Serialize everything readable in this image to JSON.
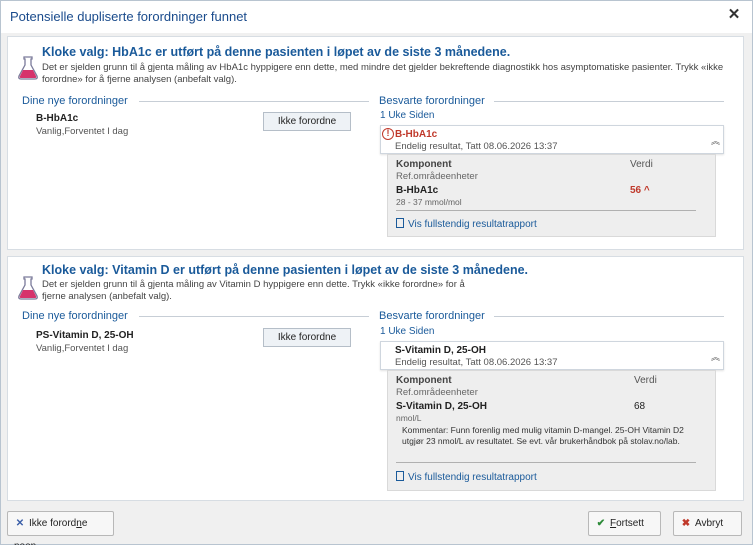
{
  "dialog": {
    "title": "Potensielle dupliserte forordninger funnet",
    "close_label": "✕"
  },
  "cards": [
    {
      "heading": "Kloke valg: HbA1c er utført på denne pasienten i løpet av de siste 3 månedene.",
      "description": "Det er sjelden grunn til å gjenta måling av HbA1c hyppigere enn dette, med mindre det gjelder bekreftende diagnostikk hos asymptomatiske pasienter. Trykk «ikke forordne» for å fjerne analysen (anbefalt valg).",
      "new_orders_label": "Dine nye forordninger",
      "order_name": "B-HbA1c",
      "order_sub": "Vanlig,Forventet I dag",
      "ikke_button": "Ikke forordne",
      "answered_label": "Besvarte forordninger",
      "since": "1 Uke Siden",
      "result_name": "B-HbA1c",
      "result_sub": "Endelig resultat, Tatt 08.06.2026 13:37",
      "component_label": "Komponent",
      "value_label": "Verdi",
      "ref_label": "Ref.områdeenheter",
      "test_name": "B-HbA1c",
      "test_range": "28 - 37 mmol/mol",
      "test_value": "56",
      "flag": "^",
      "link": "Vis fullstendig resultatrapport"
    },
    {
      "heading": "Kloke valg: Vitamin D er utført på denne pasienten i løpet av de siste 3 månedene.",
      "description": "Det er sjelden grunn til å gjenta måling av Vitamin D hyppigere enn dette. Trykk «ikke forordne» for å fjerne analysen (anbefalt valg).",
      "new_orders_label": "Dine nye forordninger",
      "order_name": "PS-Vitamin D, 25-OH",
      "order_sub": "Vanlig,Forventet I dag",
      "ikke_button": "Ikke forordne",
      "answered_label": "Besvarte forordninger",
      "since": "1 Uke Siden",
      "result_name": "S-Vitamin D, 25-OH",
      "result_sub": "Endelig resultat, Tatt 08.06.2026 13:37",
      "component_label": "Komponent",
      "value_label": "Verdi",
      "ref_label": "Ref.områdeenheter",
      "test_name": "S-Vitamin D, 25-OH",
      "test_range": "nmol/L",
      "test_value": "68",
      "comment": "Kommentar: Funn forenlig med mulig vitamin D-mangel. 25-OH Vitamin D2 utgjør 23 nmol/L av resultatet. Se evt. vår brukerhåndbok på stolav.no/lab.",
      "link": "Vis fullstendig resultatrapport"
    }
  ],
  "footer": {
    "ikke_noen_pre": "Ikke forord",
    "ikke_noen_ul": "n",
    "ikke_noen_post": "e noen",
    "fortsett_ul": "F",
    "fortsett_post": "ortsett",
    "avbryt": "Avbryt"
  },
  "icons": {
    "flask": "flask-icon",
    "alert": "alert-circle-icon",
    "collapse": "chevron-double-up-icon",
    "report": "document-icon"
  },
  "colors": {
    "accent": "#1a5a9a",
    "flask": "#d6336c",
    "alert": "#c0392b",
    "ok": "#2e8b3a"
  }
}
